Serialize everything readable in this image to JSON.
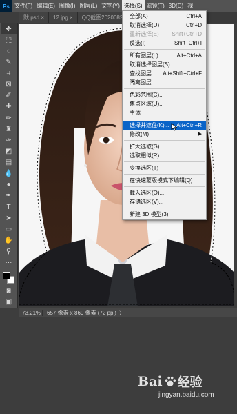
{
  "app": {
    "logo_text": "Ps"
  },
  "menubar": {
    "items": [
      {
        "label": "文件(F)"
      },
      {
        "label": "编辑(E)"
      },
      {
        "label": "图像(I)"
      },
      {
        "label": "图层(L)"
      },
      {
        "label": "文字(Y)"
      },
      {
        "label": "选择(S)",
        "active": true
      },
      {
        "label": "滤镜(T)"
      },
      {
        "label": "3D(D)"
      },
      {
        "label": "视"
      }
    ]
  },
  "tabs": [
    {
      "label": "默.psd ×"
    },
    {
      "label": "12.jpg ×"
    },
    {
      "label": "QQ截图2020082"
    }
  ],
  "select_menu": {
    "groups": [
      [
        {
          "label": "全部(A)",
          "shortcut": "Ctrl+A",
          "disabled": false
        },
        {
          "label": "取消选择(D)",
          "shortcut": "Ctrl+D",
          "disabled": false
        },
        {
          "label": "重新选择(E)",
          "shortcut": "Shift+Ctrl+D",
          "disabled": true
        },
        {
          "label": "反选(I)",
          "shortcut": "Shift+Ctrl+I",
          "disabled": false
        }
      ],
      [
        {
          "label": "所有图层(L)",
          "shortcut": "Alt+Ctrl+A",
          "disabled": false
        },
        {
          "label": "取消选择图层(S)",
          "shortcut": "",
          "disabled": false
        },
        {
          "label": "查找图层",
          "shortcut": "Alt+Shift+Ctrl+F",
          "disabled": false
        },
        {
          "label": "隔离图层",
          "shortcut": "",
          "disabled": false
        }
      ],
      [
        {
          "label": "色彩范围(C)...",
          "shortcut": "",
          "disabled": false
        },
        {
          "label": "焦点区域(U)...",
          "shortcut": "",
          "disabled": false
        },
        {
          "label": "主体",
          "shortcut": "",
          "disabled": false
        }
      ],
      [
        {
          "label": "选择并遮住(K)...",
          "shortcut": "Alt+Ctrl+R",
          "disabled": false,
          "highlight": true
        },
        {
          "label": "修改(M)",
          "shortcut": "",
          "disabled": false,
          "submenu": true
        }
      ],
      [
        {
          "label": "扩大选取(G)",
          "shortcut": "",
          "disabled": false
        },
        {
          "label": "选取相似(R)",
          "shortcut": "",
          "disabled": false
        }
      ],
      [
        {
          "label": "变换选区(T)",
          "shortcut": "",
          "disabled": false
        }
      ],
      [
        {
          "label": "在快速蒙版模式下编辑(Q)",
          "shortcut": "",
          "disabled": false
        }
      ],
      [
        {
          "label": "载入选区(O)...",
          "shortcut": "",
          "disabled": false
        },
        {
          "label": "存储选区(V)...",
          "shortcut": "",
          "disabled": false
        }
      ],
      [
        {
          "label": "新建 3D 模型(3)",
          "shortcut": "",
          "disabled": false
        }
      ]
    ]
  },
  "statusbar": {
    "zoom": "73.21%",
    "info": "657 像素 x 869 像素 (72 ppi)",
    "arrow": "〉"
  },
  "tools": [
    {
      "icon": "move-icon",
      "glyph": "✥"
    },
    {
      "icon": "marquee-icon",
      "glyph": "⬚"
    },
    {
      "icon": "lasso-icon",
      "glyph": "◌"
    },
    {
      "icon": "quick-select-icon",
      "glyph": "✎"
    },
    {
      "icon": "crop-icon",
      "glyph": "⌗"
    },
    {
      "icon": "frame-icon",
      "glyph": "⊠"
    },
    {
      "icon": "eyedropper-icon",
      "glyph": "✐"
    },
    {
      "icon": "healing-brush-icon",
      "glyph": "✚"
    },
    {
      "icon": "brush-icon",
      "glyph": "✏"
    },
    {
      "icon": "clone-stamp-icon",
      "glyph": "♜"
    },
    {
      "icon": "history-brush-icon",
      "glyph": "✑"
    },
    {
      "icon": "eraser-icon",
      "glyph": "◩"
    },
    {
      "icon": "gradient-icon",
      "glyph": "▤"
    },
    {
      "icon": "blur-icon",
      "glyph": "💧"
    },
    {
      "icon": "dodge-icon",
      "glyph": "●"
    },
    {
      "icon": "pen-icon",
      "glyph": "✒"
    },
    {
      "icon": "type-icon",
      "glyph": "T"
    },
    {
      "icon": "path-select-icon",
      "glyph": "➤"
    },
    {
      "icon": "rectangle-icon",
      "glyph": "▭"
    },
    {
      "icon": "hand-icon",
      "glyph": "✋"
    },
    {
      "icon": "zoom-icon",
      "glyph": "⚲"
    },
    {
      "icon": "more-icon",
      "glyph": "···"
    }
  ],
  "bottom_tools": [
    {
      "icon": "quick-mask-icon",
      "glyph": "◙"
    },
    {
      "icon": "screen-mode-icon",
      "glyph": "▣"
    }
  ],
  "watermark": {
    "brand_left": "Bai",
    "brand_right": "经验",
    "url": "jingyan.baidu.com"
  },
  "colors": {
    "menu_highlight": "#0a64c8",
    "ui_dark": "#3d3d3d",
    "toolbar": "#535353"
  }
}
